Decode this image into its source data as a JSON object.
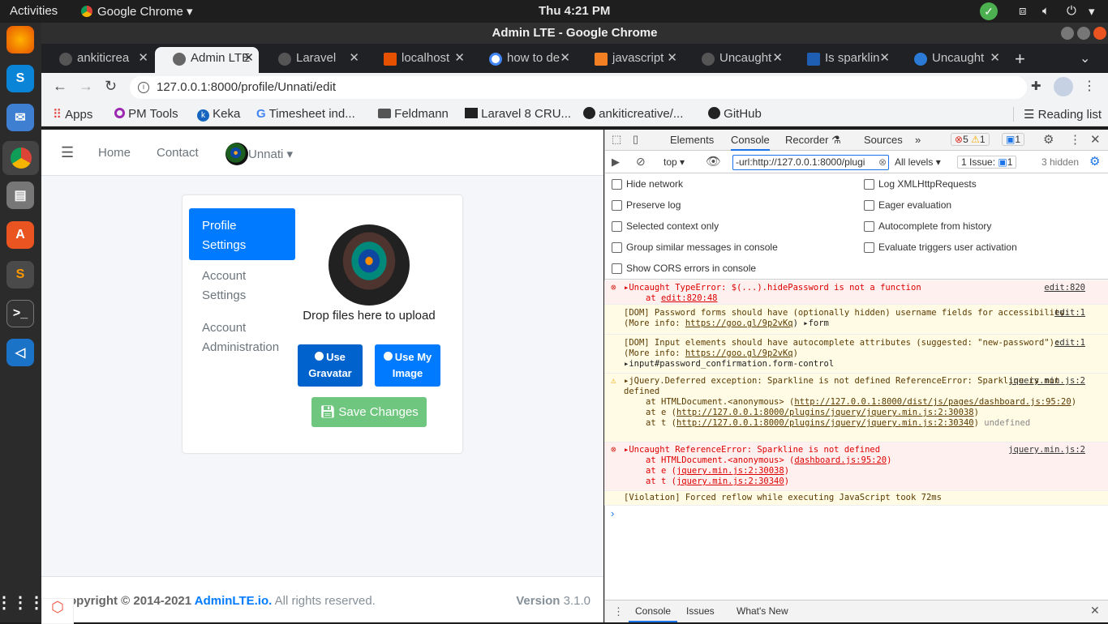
{
  "topbar": {
    "activities": "Activities",
    "app_name": "Google Chrome",
    "clock": "Thu  4:21 PM"
  },
  "window": {
    "title": "Admin LTE - Google Chrome"
  },
  "tabs": [
    {
      "label": "ankiticrea"
    },
    {
      "label": "Admin LTE"
    },
    {
      "label": "Laravel"
    },
    {
      "label": "localhost"
    },
    {
      "label": "how to de"
    },
    {
      "label": "javascript"
    },
    {
      "label": "Uncaught"
    },
    {
      "label": "Is sparklin"
    },
    {
      "label": "Uncaught"
    }
  ],
  "address": {
    "url": "127.0.0.1:8000/profile/Unnati/edit"
  },
  "bookmarks": [
    "Apps",
    "PM Tools",
    "Keka",
    "Timesheet ind...",
    "Feldmann",
    "Laravel 8 CRU...",
    "ankiticreative/...",
    "GitHub"
  ],
  "reading_list": "Reading list",
  "navbar": {
    "home": "Home",
    "contact": "Contact",
    "user": "Unnati"
  },
  "profile": {
    "menu": [
      "Profile Settings",
      "Account Settings",
      "Account Administration"
    ],
    "drop_text": "Drop files here to upload",
    "use_gravatar": "Use Gravatar",
    "use_my_image": "Use My Image",
    "save": "Save Changes"
  },
  "footer": {
    "copyright_prefix": "opyright © 2014-2021 ",
    "brand": "AdminLTE.io.",
    "rights": " All rights reserved.",
    "version_label": "Version",
    "version": "3.1.0"
  },
  "devtools": {
    "tabs": [
      "Elements",
      "Console",
      "Recorder",
      "Sources"
    ],
    "error_count": "5",
    "warning_count": "1",
    "info_count": "1",
    "context": "top",
    "filter": "-url:http://127.0.0.1:8000/plugi",
    "levels": "All levels",
    "issues": "1 Issue:",
    "issues_count": "1",
    "hidden": "3 hidden",
    "settings_left": [
      "Hide network",
      "Preserve log",
      "Selected context only",
      "Group similar messages in console",
      "Show CORS errors in console"
    ],
    "settings_right": [
      "Log XMLHttpRequests",
      "Eager evaluation",
      "Autocomplete from history",
      "Evaluate triggers user activation"
    ],
    "messages": {
      "m1": {
        "text": "▸Uncaught TypeError: $(...).hidePassword is not a function",
        "sub": "at ",
        "sub_link": "edit:820:48",
        "src": "edit:820"
      },
      "m2": {
        "text": "[DOM] Password forms should have (optionally hidden) username fields for accessibility: (More info: ",
        "link": "https://goo.gl/9p2vKq",
        "tail": ") ▸form",
        "src": "edit:1"
      },
      "m3": {
        "text": "[DOM] Input elements should have autocomplete attributes (suggested: \"new-password\"): (More info: ",
        "link": "https://goo.gl/9p2vKq",
        "tail": ")",
        "line2": "▸input#password_confirmation.form-control",
        "src": "edit:1"
      },
      "m4": {
        "text": "▸jQuery.Deferred exception: Sparkline is not defined ReferenceError: Sparkline is not defined",
        "l1": "at HTMLDocument.<anonymous> (",
        "l1_link": "http://127.0.0.1:8000/dist/js/pages/dashboard.js:95:20",
        "l2": "at e (",
        "l2_link": "http://127.0.0.1:8000/plugins/jquery/jquery.min.js:2:30038",
        "l3": "at t (",
        "l3_link": "http://127.0.0.1:8000/plugins/jquery/jquery.min.js:2:30340",
        "l3_tail": "undefined",
        "src": "jquery.min.js:2"
      },
      "m5": {
        "text": "▸Uncaught ReferenceError: Sparkline is not defined",
        "l1": "at HTMLDocument.<anonymous> (",
        "l1_link": "dashboard.js:95:20",
        "l2": "at e (",
        "l2_link": "jquery.min.js:2:30038",
        "l3": "at t (",
        "l3_link": "jquery.min.js:2:30340",
        "src": "jquery.min.js:2"
      },
      "m6": {
        "text": "[Violation] Forced reflow while executing JavaScript took 72ms"
      }
    },
    "drawer_tabs": [
      "Console",
      "Issues",
      "What's New"
    ]
  }
}
